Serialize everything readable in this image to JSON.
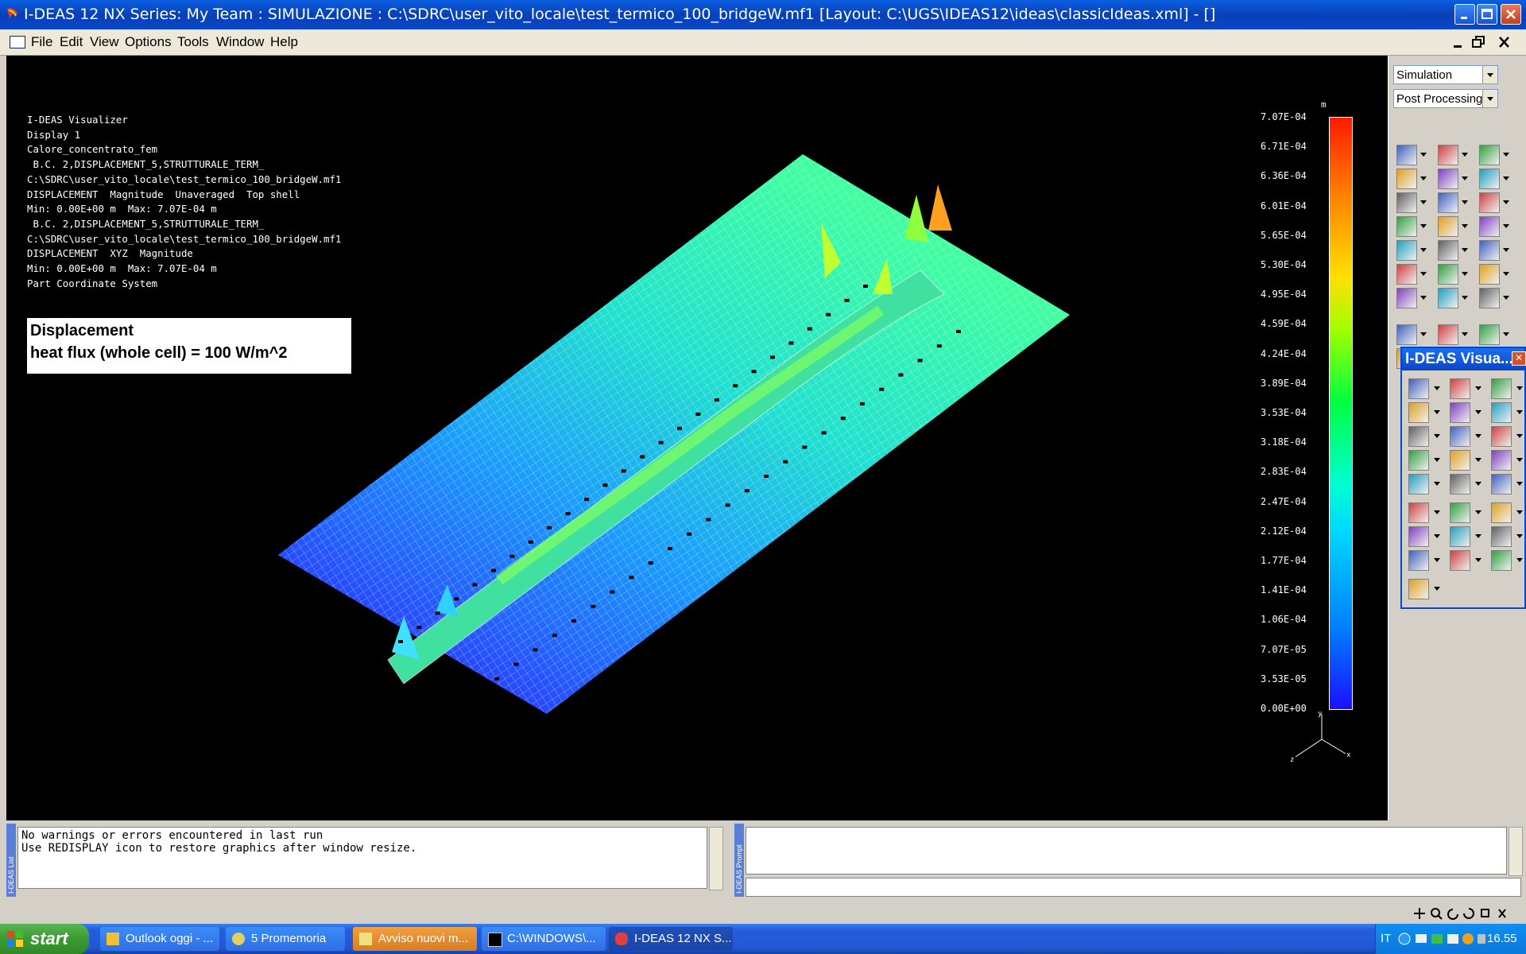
{
  "window": {
    "title": "I-DEAS 12 NX Series:    My Team : SIMULAZIONE : C:\\SDRC\\user_vito_locale\\test_termico_100_bridgeW.mf1    [Layout: C:\\UGS\\IDEAS12\\ideas\\classicIdeas.xml]    - []"
  },
  "menu": {
    "items": [
      "File",
      "Edit",
      "View",
      "Options",
      "Tools",
      "Window",
      "Help"
    ]
  },
  "viewport": {
    "info_lines": [
      "I-DEAS Visualizer",
      "Display 1",
      "Calore_concentrato_fem",
      " B.C. 2,DISPLACEMENT_5,STRUTTURALE_TERM_",
      "C:\\SDRC\\user_vito_locale\\test_termico_100_bridgeW.mf1",
      "DISPLACEMENT  Magnitude  Unaveraged  Top shell",
      "Min: 0.00E+00 m  Max: 7.07E-04 m",
      " B.C. 2,DISPLACEMENT_5,STRUTTURALE_TERM_",
      "C:\\SDRC\\user_vito_locale\\test_termico_100_bridgeW.mf1",
      "DISPLACEMENT  XYZ  Magnitude",
      "Min: 0.00E+00 m  Max: 7.07E-04 m",
      "Part Coordinate System"
    ],
    "annotation_line1": "Displacement",
    "annotation_line2": "heat flux (whole cell) = 100 W/m^2",
    "legend_unit": "m",
    "legend_values": [
      "7.07E-04",
      "6.71E-04",
      "6.36E-04",
      "6.01E-04",
      "5.65E-04",
      "5.30E-04",
      "4.95E-04",
      "4.59E-04",
      "4.24E-04",
      "3.89E-04",
      "3.53E-04",
      "3.18E-04",
      "2.83E-04",
      "2.47E-04",
      "2.12E-04",
      "1.77E-04",
      "1.41E-04",
      "1.06E-04",
      "7.07E-05",
      "3.53E-05",
      "0.00E+00"
    ],
    "triad": {
      "y": "y",
      "x": "x",
      "z": "z"
    }
  },
  "right_panel": {
    "task_select": "Simulation",
    "mode_select": "Post Processing"
  },
  "palette": {
    "title": "I-DEAS Visua..."
  },
  "list_panel": {
    "label": "I-DEAS List",
    "lines": "No warnings or errors encountered in last run\nUse REDISPLAY icon to restore graphics after window resize."
  },
  "prompt_panel": {
    "label": "I-DEAS Prompt"
  },
  "taskbar": {
    "start_label": "start",
    "tasks": [
      "Outlook oggi - ...",
      "5 Promemoria",
      "Avviso nuovi m...",
      "C:\\WINDOWS\\...",
      "I-DEAS 12 NX S..."
    ],
    "language": "IT",
    "clock": "16.55"
  }
}
